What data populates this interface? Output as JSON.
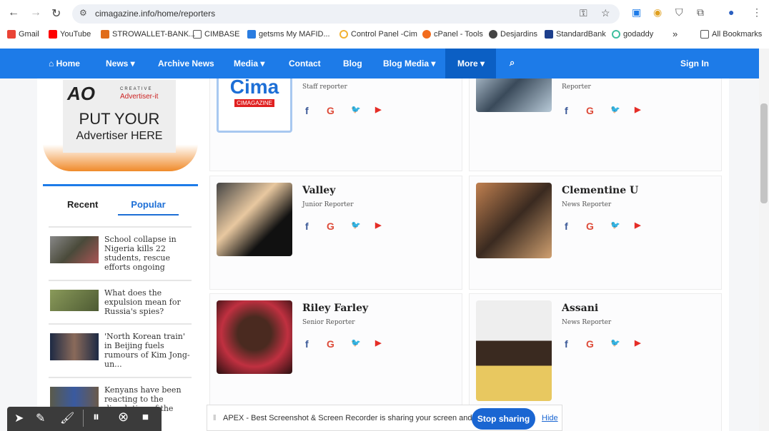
{
  "browser": {
    "url": "cimagazine.info/home/reporters",
    "bookmarks": [
      "Gmail",
      "YouTube",
      "STROWALLET-BANK...",
      "CIMBASE",
      "getsms My MAFID...",
      "Control Panel -Cim",
      "cPanel - Tools",
      "Desjardins",
      "StandardBank",
      "godaddy"
    ],
    "bookmark_colors": [
      "#ea4335",
      "#ff0000",
      "#e06c1a",
      "#555555",
      "#2a7de1",
      "#f2b233",
      "#f26b1d",
      "#444444",
      "#1d3f8c",
      "#3fbf9f"
    ],
    "overflow": "»",
    "all_bookmarks": "All Bookmarks"
  },
  "nav": {
    "items": [
      "Home",
      "News ▾",
      "Archive News",
      "Media ▾",
      "Contact",
      "Blog",
      "Blog Media ▾",
      "More ▾"
    ],
    "search": "⌕",
    "sign_in": "Sign In",
    "active": "More ▾",
    "color": "#1d7be8"
  },
  "sidebar": {
    "ad": {
      "brand": "CREATIVE",
      "brand2": "Advertiser-it",
      "line1": "PUT YOUR",
      "line2": "Advertiser HERE"
    },
    "tabs": {
      "recent": "Recent",
      "popular": "Popular"
    },
    "items": [
      {
        "title": "School collapse in Nigeria kills 22 students, rescue efforts ongoing"
      },
      {
        "title": "What does the expulsion mean for Russia's spies?"
      },
      {
        "title": "'North Korean train' in Beijing fuels rumours of Kim Jong-un..."
      },
      {
        "title": "Kenyans have been reacting to the dissolution of the cabinet"
      }
    ]
  },
  "reporters": [
    {
      "name": "",
      "role": "Staff reporter",
      "logo": "Cima",
      "logo_sub": "CIMAGAZINE"
    },
    {
      "name": "",
      "role": "Reporter"
    },
    {
      "name": "Valley",
      "role": "Junior Reporter"
    },
    {
      "name": "Clementine U",
      "role": "News Reporter"
    },
    {
      "name": "Riley Farley",
      "role": "Senior Reporter"
    },
    {
      "name": "Assani",
      "role": "News Reporter"
    }
  ],
  "social": {
    "facebook": "f",
    "google": "G",
    "twitter": "🐦",
    "youtube": "▶"
  },
  "recorder": {
    "message": "APEX - Best Screenshot & Screen Recorder is sharing your screen and audio.",
    "stop": "Stop sharing",
    "hide": "Hide"
  }
}
